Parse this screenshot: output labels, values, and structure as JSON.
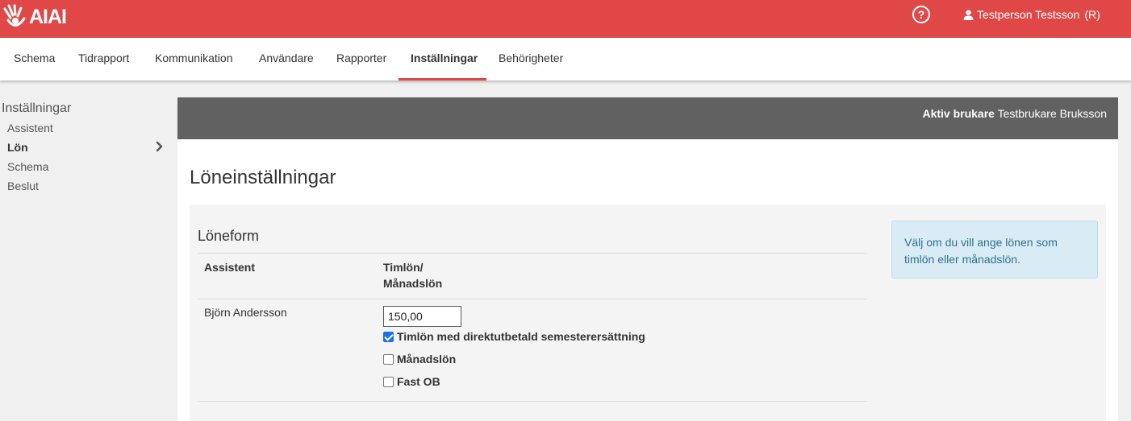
{
  "brand": {
    "logo_text": "AIAI",
    "accent": "#e04848"
  },
  "header": {
    "help_label": "?",
    "user_name": "Testperson Testsson",
    "user_role": "(R)"
  },
  "nav": {
    "items": [
      "Schema",
      "Tidrapport",
      "Kommunikation",
      "Användare",
      "Rapporter",
      "Inställningar",
      "Behörigheter"
    ],
    "active": "Inställningar"
  },
  "sidebar": {
    "title": "Inställningar",
    "items": [
      "Assistent",
      "Lön",
      "Schema",
      "Beslut"
    ],
    "active": "Lön"
  },
  "active_user": {
    "label": "Aktiv brukare",
    "name": "Testbrukare Bruksson"
  },
  "main": {
    "title": "Löneinställningar",
    "section_title": "Löneform",
    "columns": {
      "assistant": "Assistent",
      "wage_line1": "Timlön/",
      "wage_line2": "Månadslön"
    },
    "rows": [
      {
        "name": "Björn Andersson",
        "amount": "150,00",
        "options": [
          {
            "label": "Timlön med direktutbetald semesterersättning",
            "checked": true
          },
          {
            "label": "Månadslön",
            "checked": false
          },
          {
            "label": "Fast OB",
            "checked": false
          }
        ]
      }
    ]
  },
  "info_box": {
    "text": "Välj om du vill ange lönen som timlön eller månadslön."
  }
}
